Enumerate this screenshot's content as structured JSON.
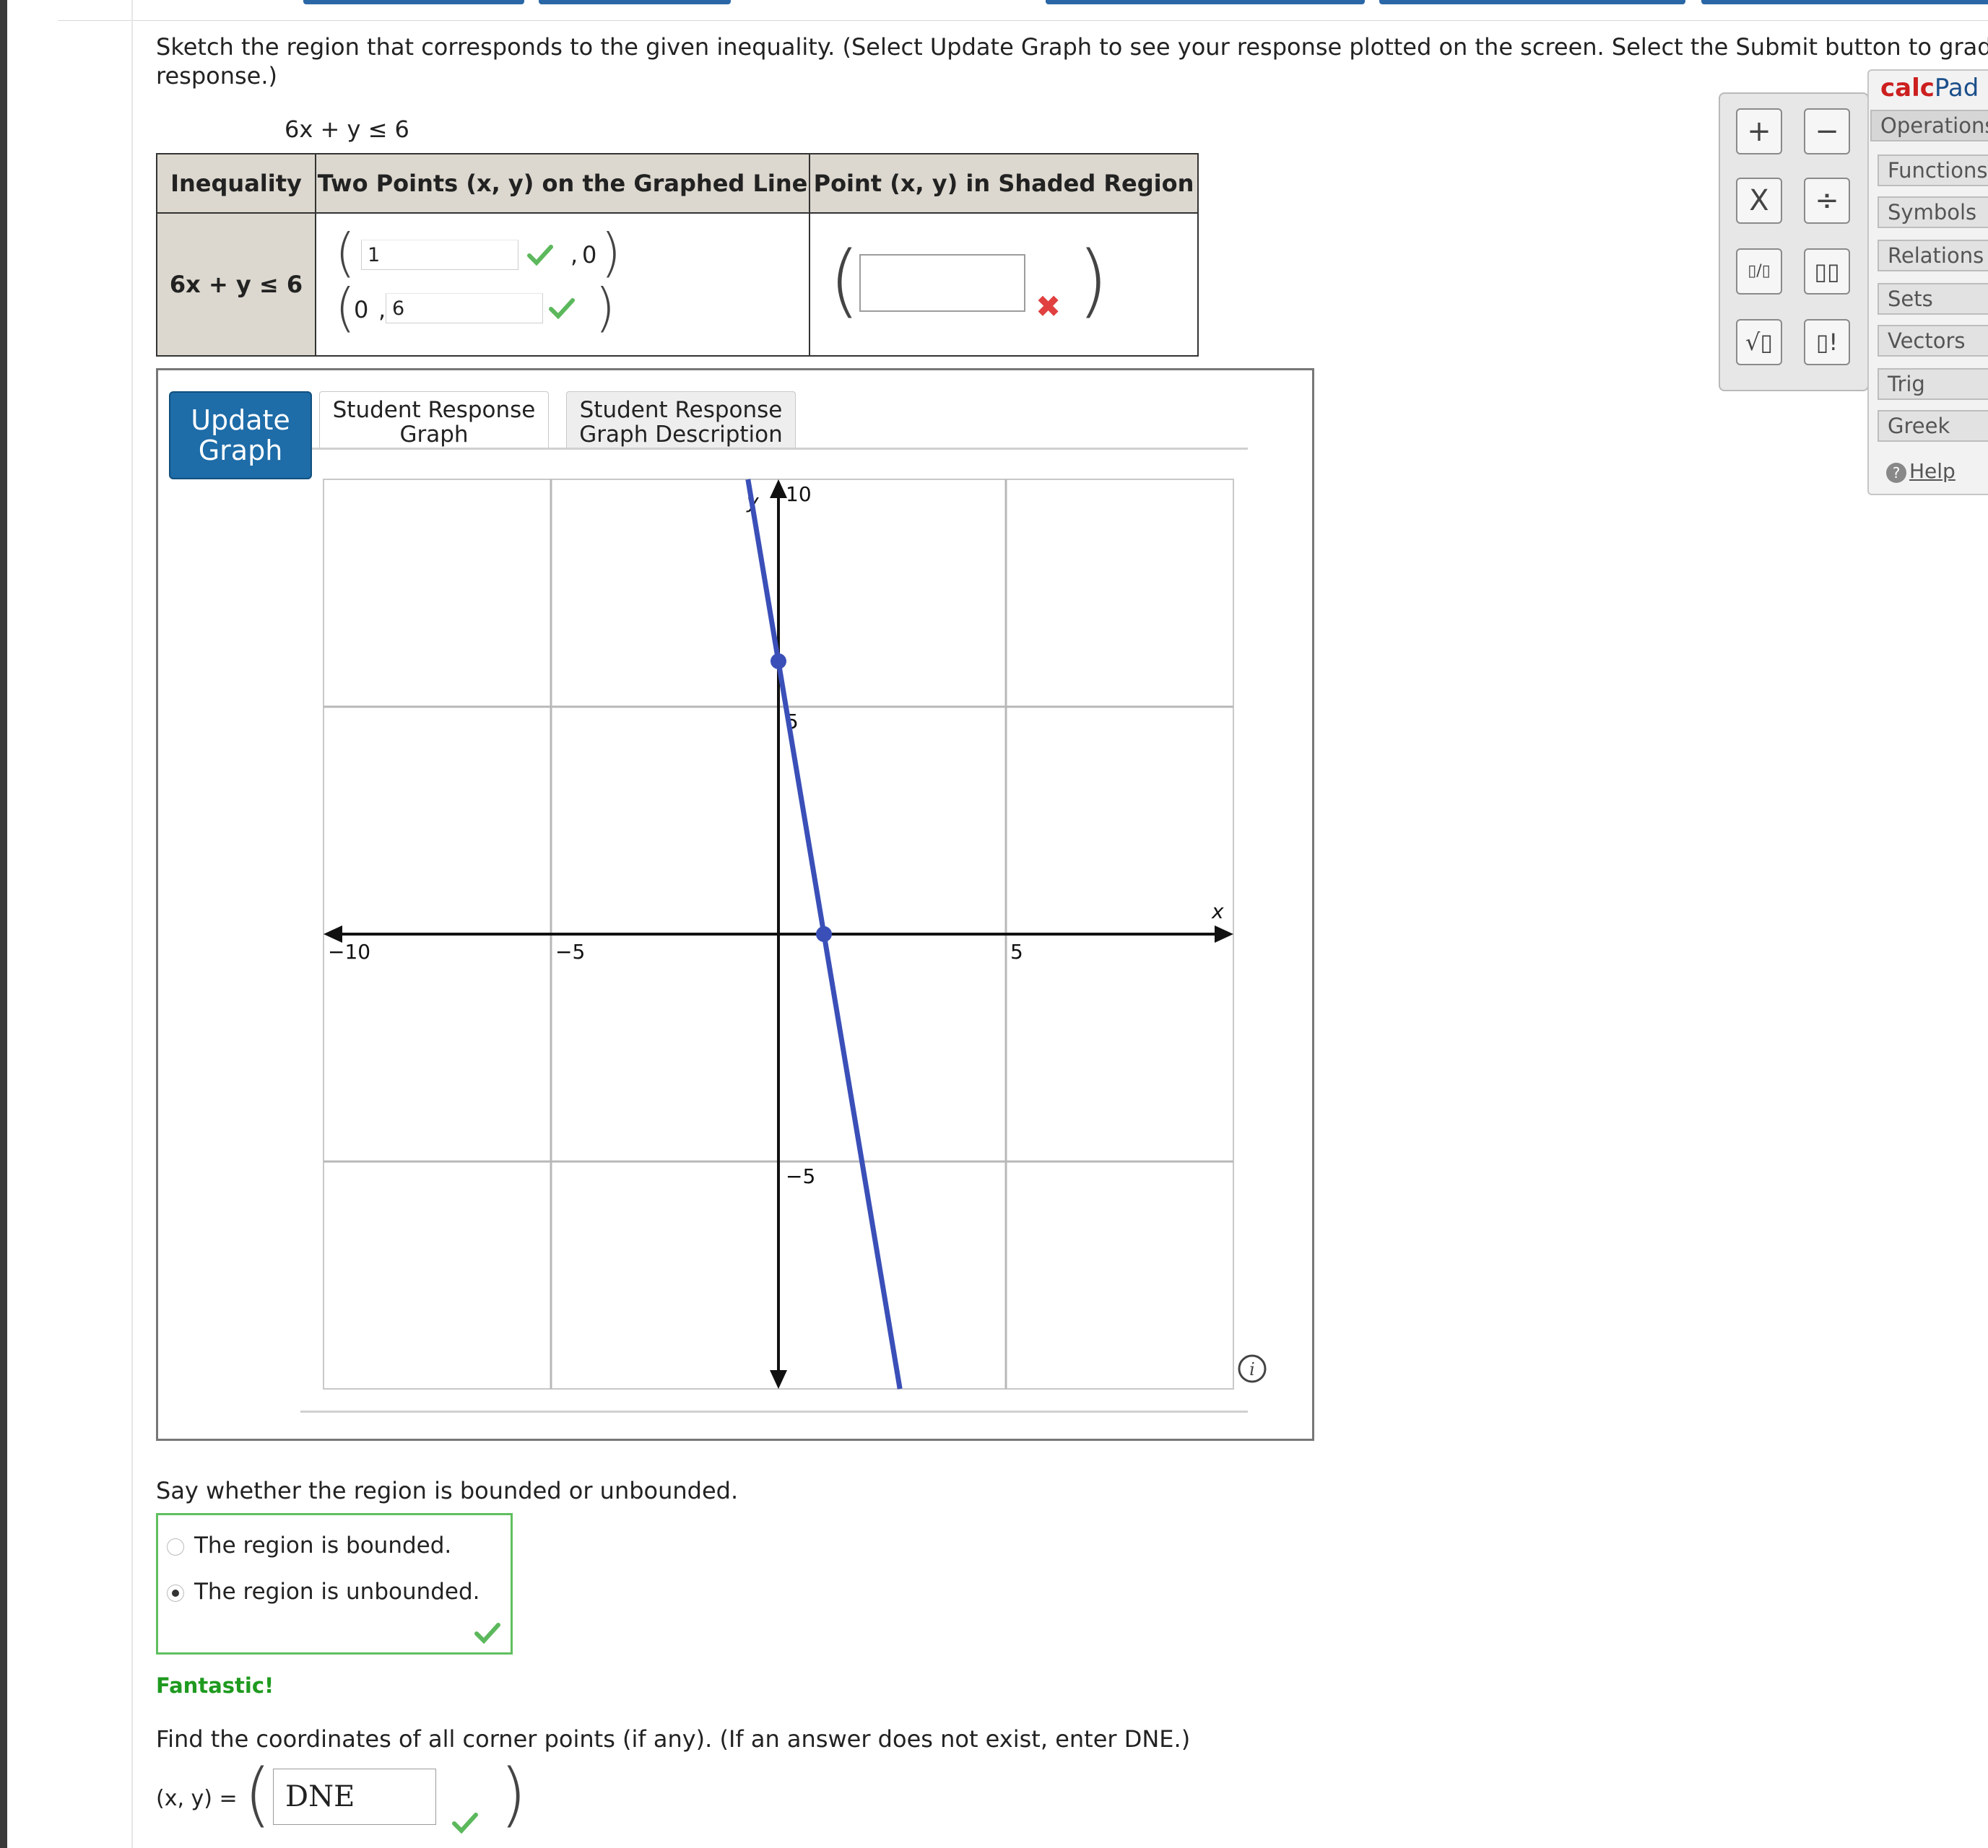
{
  "instructions": {
    "line1": "Sketch the region that corresponds to the given inequality. (Select Update Graph to see your response plotted on the screen. Select the Submit button to grade your",
    "line2": "response.)"
  },
  "inequality_label": "6x + y ≤ 6",
  "table": {
    "headers": [
      "Inequality",
      "Two Points (x, y) on the Graphed Line",
      "Point (x, y) in Shaded Region"
    ],
    "inequality": "6x + y ≤ 6",
    "point1_x": "1",
    "point1_y": "0",
    "point2_x": "0",
    "point2_y": "6",
    "shaded_point": ""
  },
  "update_button": {
    "line1": "Update",
    "line2": "Graph"
  },
  "tabs": [
    {
      "line1": "Student Response",
      "line2": "Graph"
    },
    {
      "line1": "Student Response",
      "line2": "Graph Description"
    }
  ],
  "chart_data": {
    "type": "line",
    "xlabel": "x",
    "ylabel": "y",
    "xlim": [
      -10,
      10
    ],
    "ylim": [
      -10,
      10
    ],
    "grid": true,
    "x_ticks": [
      "−10",
      "−5",
      "5"
    ],
    "y_ticks": [
      "10",
      "5",
      "−5"
    ],
    "series": [
      {
        "points": [
          [
            -0.67,
            10
          ],
          [
            2.67,
            -10
          ]
        ],
        "color": "#3a4fb8"
      }
    ],
    "marked_points": [
      [
        0,
        6
      ],
      [
        1,
        0
      ]
    ]
  },
  "calc_keys": [
    "+",
    "−",
    "X",
    "÷",
    "▯/▯",
    "▯▯",
    "√▯",
    "▯!"
  ],
  "calcpad": {
    "title_red": "calc",
    "title_blue": "Pad",
    "tabs": [
      "Operations",
      "Functions",
      "Symbols",
      "Relations",
      "Sets",
      "Vectors",
      "Trig",
      "Greek"
    ],
    "help": "Help"
  },
  "bounded_question": "Say whether the region is bounded or unbounded.",
  "options": [
    {
      "label": "The region is bounded.",
      "selected": false
    },
    {
      "label": "The region is unbounded.",
      "selected": true
    }
  ],
  "feedback": "Fantastic!",
  "corner_question": "Find the coordinates of all corner points (if any). (If an answer does not exist, enter DNE.)",
  "corner_label": "(x, y) =",
  "corner_answer": "DNE"
}
